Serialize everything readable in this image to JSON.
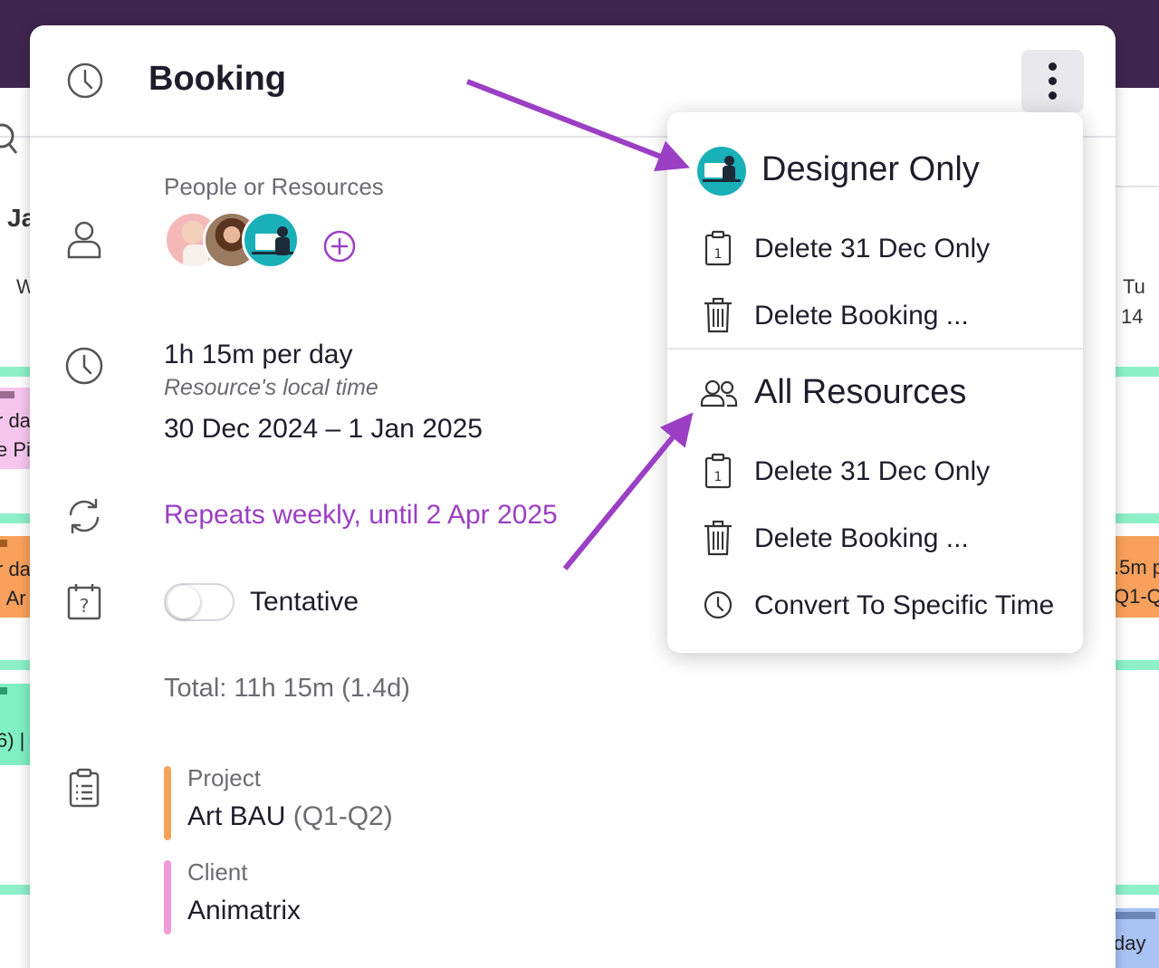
{
  "modal": {
    "title": "Booking",
    "people_label": "People or Resources",
    "duration": "1h 15m per day",
    "duration_note": "Resource's local time",
    "date_range": "30 Dec 2024 – 1 Jan 2025",
    "repeats": "Repeats weekly, until 2 Apr 2025",
    "tentative_label": "Tentative",
    "tentative_on": false,
    "total": "Total: 11h 15m (1.4d)",
    "project_label": "Project",
    "project_name": "Art BAU",
    "project_suffix": "(Q1-Q2)",
    "client_label": "Client",
    "client_name": "Animatrix",
    "colors": {
      "accent_purple": "#9b3fc4",
      "project": "#f7a25a",
      "client": "#f29ad8"
    }
  },
  "menu": {
    "section1": {
      "heading": "Designer Only",
      "items": [
        {
          "label": "Delete 31 Dec Only",
          "icon": "calendar-day-icon"
        },
        {
          "label": "Delete Booking ...",
          "icon": "trash-icon"
        }
      ]
    },
    "section2": {
      "heading": "All Resources",
      "items": [
        {
          "label": "Delete 31 Dec Only",
          "icon": "calendar-day-icon"
        },
        {
          "label": "Delete Booking ...",
          "icon": "trash-icon"
        },
        {
          "label": "Convert To Specific Time",
          "icon": "clock-icon"
        }
      ]
    }
  },
  "background": {
    "month_fragment": "Ja",
    "day_fragment": "W",
    "right_day": "Tu",
    "right_date": "14",
    "left_fragments": [
      "r da",
      "e Pi",
      "r da",
      "| Ar",
      "6) |"
    ],
    "right_fragments": [
      ".5m p",
      "Q1-Q",
      "day"
    ]
  }
}
